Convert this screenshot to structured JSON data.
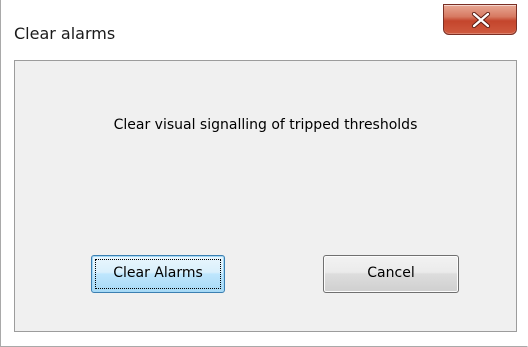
{
  "window": {
    "title": "Clear alarms",
    "close_icon": "close-icon",
    "close_color": "#c4452c"
  },
  "dialog": {
    "message": "Clear visual signalling of tripped thresholds",
    "buttons": {
      "clear_label": "Clear Alarms",
      "cancel_label": "Cancel"
    },
    "focused_button": "Clear Alarms"
  }
}
